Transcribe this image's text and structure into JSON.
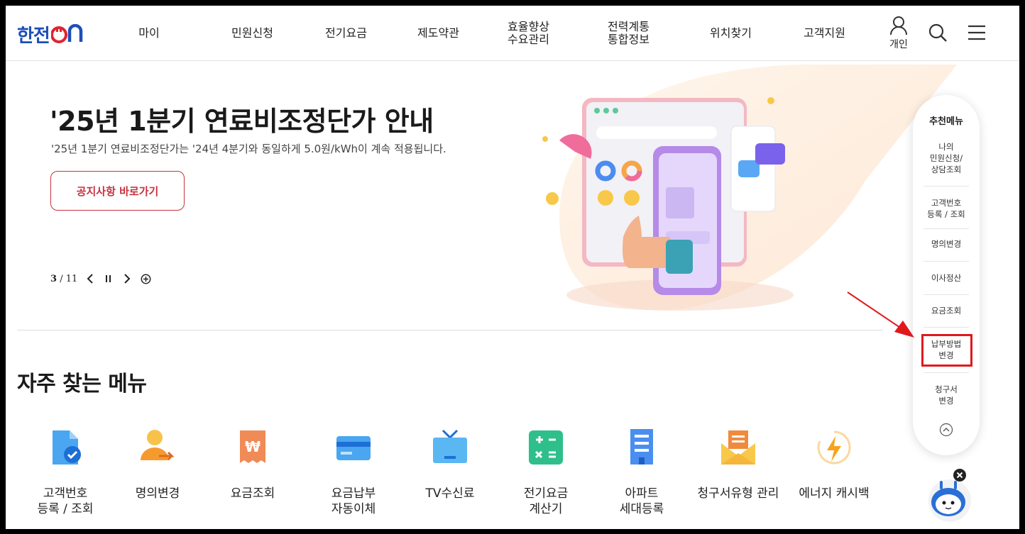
{
  "header": {
    "logo_text": "한전",
    "logo_suffix": "ON",
    "nav": [
      {
        "lines": [
          "마이"
        ]
      },
      {
        "lines": [
          "민원신청"
        ]
      },
      {
        "lines": [
          "전기요금"
        ]
      },
      {
        "lines": [
          "제도약관"
        ]
      },
      {
        "lines": [
          "효율향상",
          "수요관리"
        ]
      },
      {
        "lines": [
          "전력계통",
          "통합정보"
        ]
      },
      {
        "lines": [
          "위치찾기"
        ]
      },
      {
        "lines": [
          "고객지원"
        ]
      }
    ],
    "personal_label": "개인",
    "icons": [
      "user-icon",
      "search-icon",
      "menu-icon"
    ]
  },
  "hero": {
    "title": "'25년 1분기 연료비조정단가 안내",
    "subtitle": "'25년 1분기 연료비조정단가는 '24년 4분기와 동일하게 5.0원/kWh이 계속 적용됩니다.",
    "button_label": "공지사항 바로가기",
    "slide_current": "3",
    "slide_total": "/ 11"
  },
  "frequent": {
    "title": "자주 찾는 메뉴",
    "items": [
      {
        "label": "고객번호\n등록 / 조회",
        "icon": "document-check-icon"
      },
      {
        "label": "명의변경",
        "icon": "person-change-icon"
      },
      {
        "label": "요금조회",
        "icon": "bill-won-icon"
      },
      {
        "label": "요금납부\n자동이체",
        "icon": "credit-card-icon"
      },
      {
        "label": "TV수신료",
        "icon": "tv-icon"
      },
      {
        "label": "전기요금\n계산기",
        "icon": "calculator-icon"
      },
      {
        "label": "아파트\n세대등록",
        "icon": "apartment-icon"
      },
      {
        "label": "청구서유형 관리",
        "icon": "envelope-icon"
      },
      {
        "label": "에너지 캐시백",
        "icon": "energy-cashback-icon"
      }
    ]
  },
  "recommended": {
    "title": "추천메뉴",
    "items": [
      {
        "label": "나의\n민원신청/\n상담조회"
      },
      {
        "label": "고객번호\n등록 / 조회"
      },
      {
        "label": "명의변경"
      },
      {
        "label": "이사정산"
      },
      {
        "label": "요금조회"
      },
      {
        "label": "납부방법\n변경"
      },
      {
        "label": "청구서\n변경"
      }
    ],
    "highlighted_index": 5
  },
  "colors": {
    "brand_blue": "#1d4fb8",
    "brand_red": "#c8323f",
    "highlight_red": "#e0191c"
  }
}
